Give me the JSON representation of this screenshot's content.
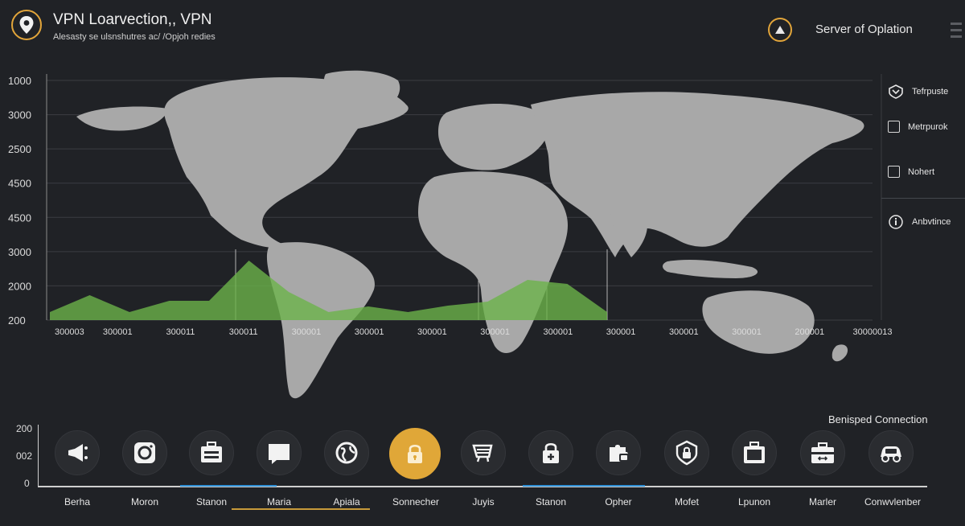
{
  "header": {
    "title": "VPN Loarvection,, VPN",
    "subtitle": "Alesasty se ulsnshutres ac/ /Opjoh redies",
    "server_label": "Server of Oplation"
  },
  "colors": {
    "accent": "#e2a53a",
    "area": "#6bb34a",
    "area_light": "#8fcf6a",
    "underline_blue": "#2e8fd6",
    "land": "#a8a8a8",
    "background": "#202226"
  },
  "map_chart": {
    "y_labels": [
      "1000",
      "3000",
      "2500",
      "4500",
      "4500",
      "3000",
      "2000",
      "200"
    ],
    "x_labels": [
      "300003",
      "300001",
      "300011",
      "300011",
      "300001",
      "300001",
      "300001",
      "300001",
      "300001",
      "300001",
      "300001",
      "300001",
      "200001",
      "30000013"
    ]
  },
  "chart_data": {
    "type": "area",
    "y_tick_labels": [
      "1000",
      "3000",
      "2500",
      "4500",
      "4500",
      "3000",
      "2000",
      "200"
    ],
    "x_tick_labels": [
      "300003",
      "300001",
      "300011",
      "300011",
      "300001",
      "300001",
      "300001",
      "300001",
      "300001",
      "300001",
      "300001",
      "300001",
      "200001",
      "30000013"
    ],
    "series": [
      {
        "values": [
          200,
          620,
          200,
          480,
          480,
          1480,
          700,
          200,
          340,
          200,
          360,
          460,
          1000,
          900,
          200
        ]
      }
    ],
    "grid": true
  },
  "options": [
    {
      "label": "Tefrpuste",
      "icon": "shield-icon"
    },
    {
      "label": "Metrpurok",
      "icon": "checkbox-icon"
    },
    {
      "label": "Nohert",
      "icon": "checkbox-icon"
    },
    {
      "label": "Anbvtince",
      "icon": "info-icon"
    }
  ],
  "connections": {
    "title": "Benisped Connection",
    "y_labels": [
      "200",
      "002",
      "0"
    ],
    "items": [
      {
        "label": "Berha",
        "icon": "megaphone-icon"
      },
      {
        "label": "Moron",
        "icon": "camera-icon"
      },
      {
        "label": "Stanon",
        "icon": "briefcase-icon"
      },
      {
        "label": "Maria",
        "icon": "message-icon"
      },
      {
        "label": "Apiala",
        "icon": "globe-icon"
      },
      {
        "label": "Sonnecher",
        "icon": "lock-icon",
        "active": true
      },
      {
        "label": "Juyis",
        "icon": "cart-icon"
      },
      {
        "label": "Stanon",
        "icon": "lock-plus-icon"
      },
      {
        "label": "Opher",
        "icon": "puzzle-icon"
      },
      {
        "label": "Mofet",
        "icon": "shield-lock-icon"
      },
      {
        "label": "Lpunon",
        "icon": "case-icon"
      },
      {
        "label": "Marler",
        "icon": "toolbox-icon"
      },
      {
        "label": "Conwvlenber",
        "icon": "car-icon"
      }
    ]
  }
}
